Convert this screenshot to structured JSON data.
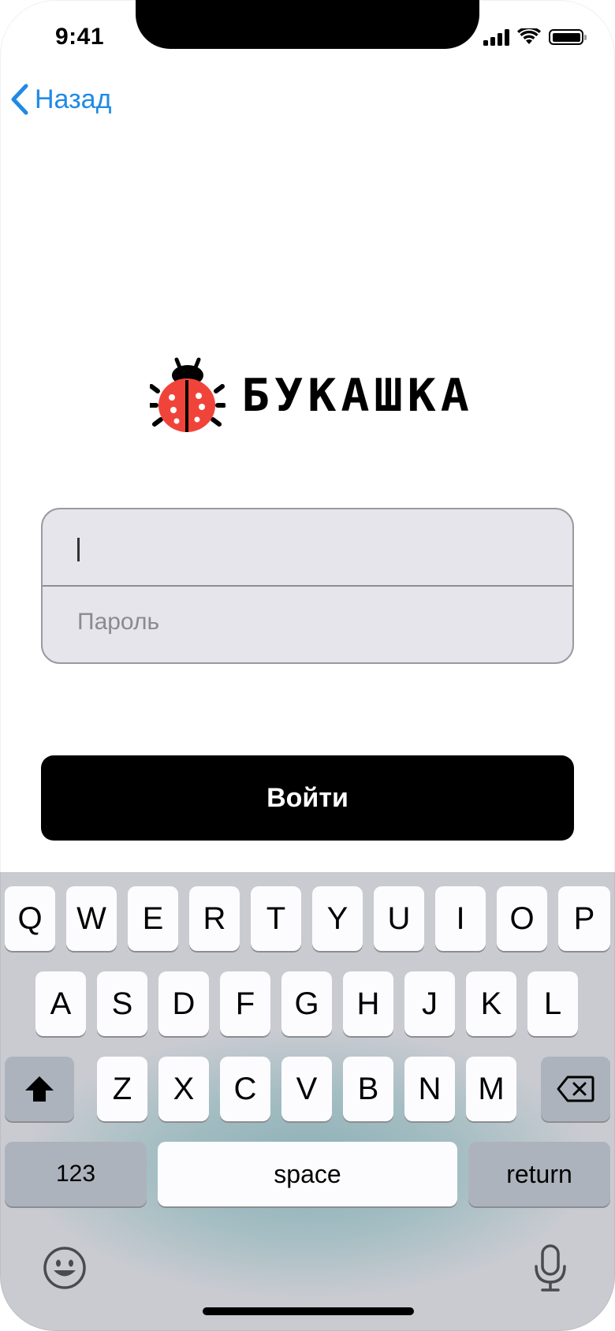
{
  "status_bar": {
    "time": "9:41"
  },
  "nav": {
    "back_label": "Назад"
  },
  "logo": {
    "text": "БУКАШКА",
    "bug_color": "#f0443a"
  },
  "form": {
    "login_value": "",
    "password_placeholder": "Пароль",
    "submit_label": "Войти"
  },
  "keyboard": {
    "row1": [
      "Q",
      "W",
      "E",
      "R",
      "T",
      "Y",
      "U",
      "I",
      "O",
      "P"
    ],
    "row2": [
      "A",
      "S",
      "D",
      "F",
      "G",
      "H",
      "J",
      "K",
      "L"
    ],
    "row3": [
      "Z",
      "X",
      "C",
      "V",
      "B",
      "N",
      "M"
    ],
    "numbers_label": "123",
    "space_label": "space",
    "return_label": "return"
  },
  "colors": {
    "accent": "#1f8ae6",
    "button": "#000000",
    "field_bg": "#e5e5eb"
  }
}
